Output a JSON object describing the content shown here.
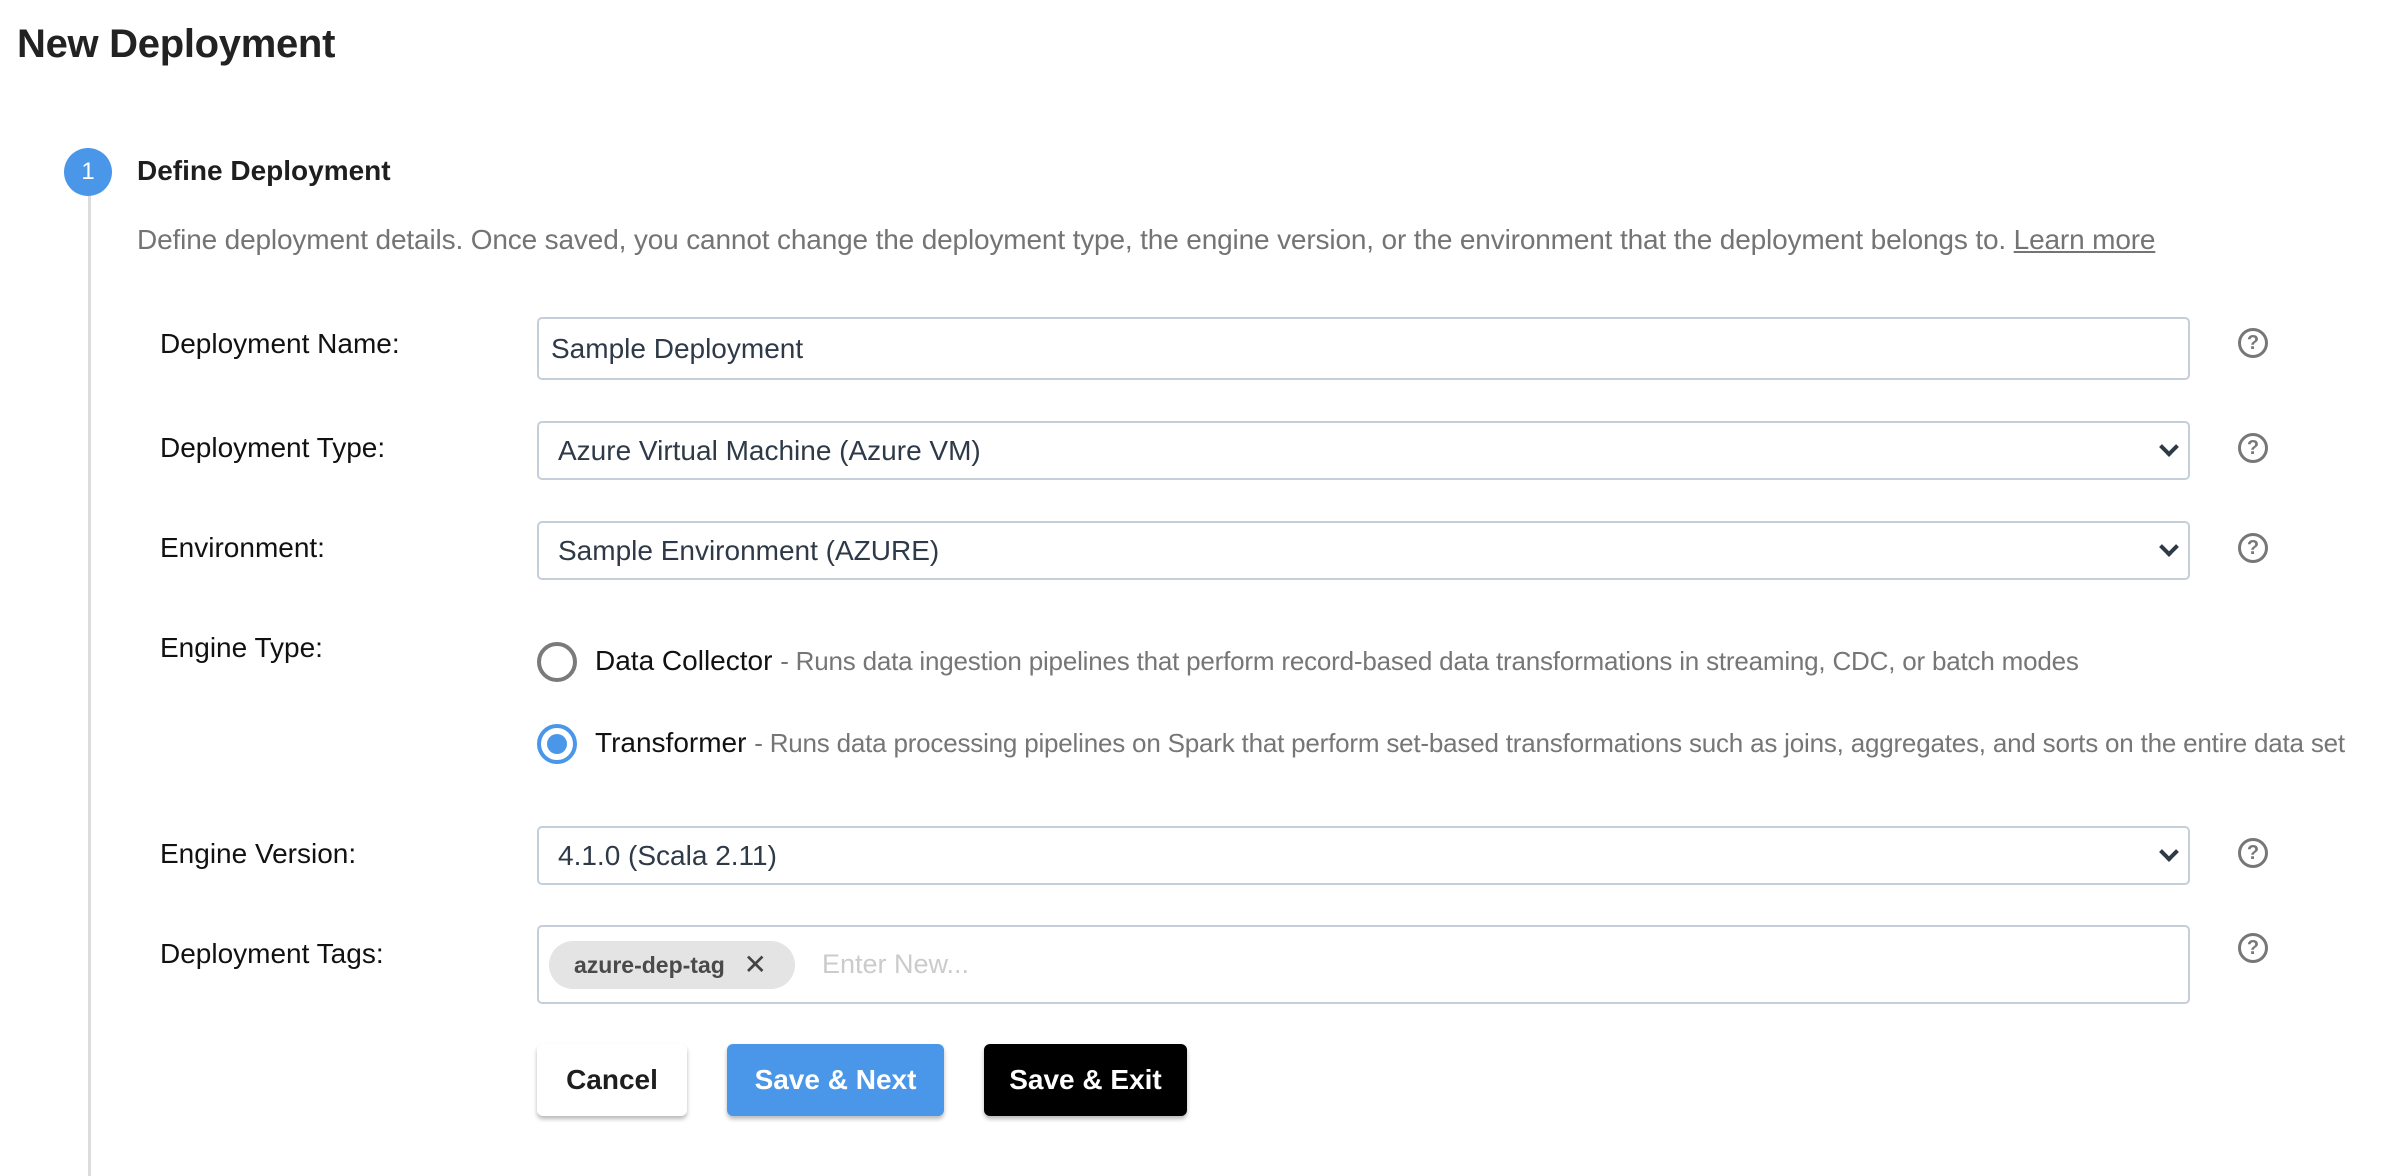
{
  "page": {
    "title": "New Deployment"
  },
  "step": {
    "number": "1",
    "title": "Define Deployment",
    "description": "Define deployment details. Once saved, you cannot change the deployment type, the engine version, or the environment that the deployment belongs to.",
    "learn_more": "Learn more"
  },
  "form": {
    "deployment_name": {
      "label": "Deployment Name:",
      "value": "Sample Deployment"
    },
    "deployment_type": {
      "label": "Deployment Type:",
      "selected": "Azure Virtual Machine (Azure VM)"
    },
    "environment": {
      "label": "Environment:",
      "selected": "Sample Environment (AZURE)"
    },
    "engine_type": {
      "label": "Engine Type:",
      "options": [
        {
          "name": "Data Collector",
          "description": "- Runs data ingestion pipelines that perform record-based data transformations in streaming, CDC, or batch modes",
          "checked": false
        },
        {
          "name": "Transformer",
          "description": "- Runs data processing pipelines on Spark that perform set-based transformations such as joins, aggregates, and sorts on the entire data set",
          "checked": true
        }
      ]
    },
    "engine_version": {
      "label": "Engine Version:",
      "selected": "4.1.0 (Scala 2.11)"
    },
    "deployment_tags": {
      "label": "Deployment Tags:",
      "tags": [
        "azure-dep-tag"
      ],
      "placeholder": "Enter New..."
    },
    "help_icon": "?"
  },
  "buttons": {
    "cancel": "Cancel",
    "save_next": "Save & Next",
    "save_exit": "Save & Exit"
  },
  "colors": {
    "accent": "#4a96e8",
    "primary_dark": "#000000",
    "field_border": "#c5cfda"
  }
}
